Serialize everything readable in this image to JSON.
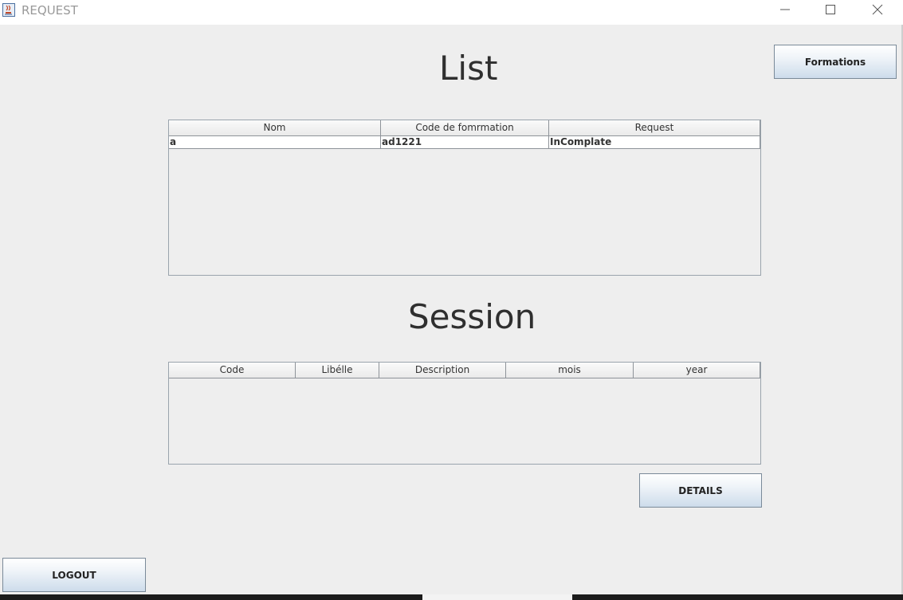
{
  "window": {
    "title": "REQUEST"
  },
  "headings": {
    "list": "List",
    "session": "Session"
  },
  "buttons": {
    "formations": "Formations",
    "details": "DETAILS",
    "logout": "LOGOUT"
  },
  "list_table": {
    "columns": [
      "Nom",
      "Code de fomrmation",
      "Request"
    ],
    "rows": [
      [
        "a",
        "ad1221",
        "InComplate"
      ]
    ]
  },
  "session_table": {
    "columns": [
      "Code",
      "Libélle",
      "Description",
      "mois",
      "year"
    ],
    "rows": []
  },
  "colors": {
    "background": "#eeeeee",
    "button_gradient_bottom": "#cddceb",
    "border": "#9aa4ad"
  },
  "icons": [
    "java-app-icon",
    "minimize-icon",
    "maximize-icon",
    "close-icon"
  ]
}
